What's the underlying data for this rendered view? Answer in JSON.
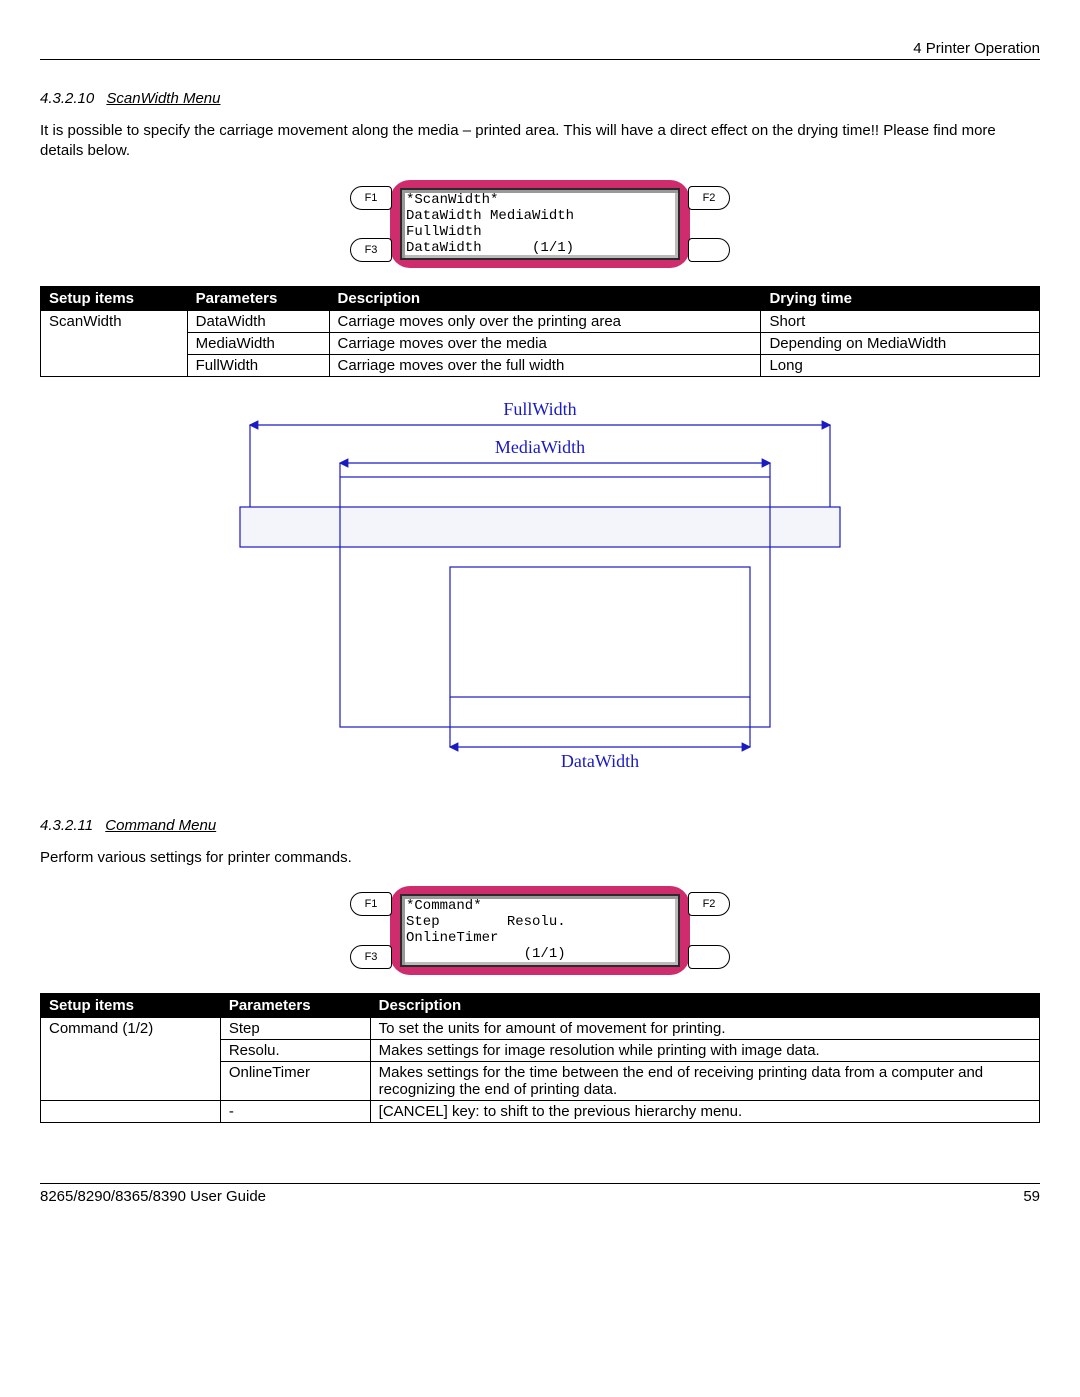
{
  "header": {
    "right": "4 Printer Operation"
  },
  "sections": {
    "s1": {
      "num": "4.3.2.10",
      "title": "ScanWidth Menu",
      "body": "It is possible to specify the carriage movement along the media – printed area. This will have a direct effect on the drying time!! Please find more details below."
    },
    "s2": {
      "num": "4.3.2.11",
      "title": "Command Menu",
      "body": "Perform various settings for printer commands."
    }
  },
  "lcd1": {
    "f1": "F1",
    "f2": "F2",
    "f3": "F3",
    "f4": "",
    "line1": "*ScanWidth*",
    "line2": "DataWidth MediaWidth",
    "line3": "FullWidth",
    "line4": "DataWidth      (1/1)"
  },
  "lcd2": {
    "f1": "F1",
    "f2": "F2",
    "f3": "F3",
    "f4": "",
    "line1": "*Command*",
    "line2": "Step        Resolu.",
    "line3": "OnlineTimer",
    "line4": "              (1/1)"
  },
  "table1": {
    "h1": "Setup items",
    "h2": "Parameters",
    "h3": "Description",
    "h4": "Drying time",
    "r1c1": "ScanWidth",
    "r1c2": "DataWidth",
    "r1c3": "Carriage moves only over the printing area",
    "r1c4": "Short",
    "r2c2": "MediaWidth",
    "r2c3": "Carriage moves over the media",
    "r2c4": "Depending on MediaWidth",
    "r3c2": "FullWidth",
    "r3c3": "Carriage moves over the full width",
    "r3c4": "Long"
  },
  "diagram": {
    "full": "FullWidth",
    "media": "MediaWidth",
    "data": "DataWidth"
  },
  "table2": {
    "h1": "Setup items",
    "h2": "Parameters",
    "h3": "Description",
    "r1c1": "Command (1/2)",
    "r1c2": "Step",
    "r1c3": "To set the units for amount of movement for printing.",
    "r2c2": "Resolu.",
    "r2c3": "Makes settings for image resolution while printing with image data.",
    "r3c2": "OnlineTimer",
    "r3c3": "Makes settings for the time between the end of receiving printing data from a computer and recognizing the end of printing data.",
    "r4c2": "-",
    "r4c3": "[CANCEL] key: to shift to the previous hierarchy menu."
  },
  "footer": {
    "left": "8265/8290/8365/8390 User Guide",
    "right": "59"
  }
}
